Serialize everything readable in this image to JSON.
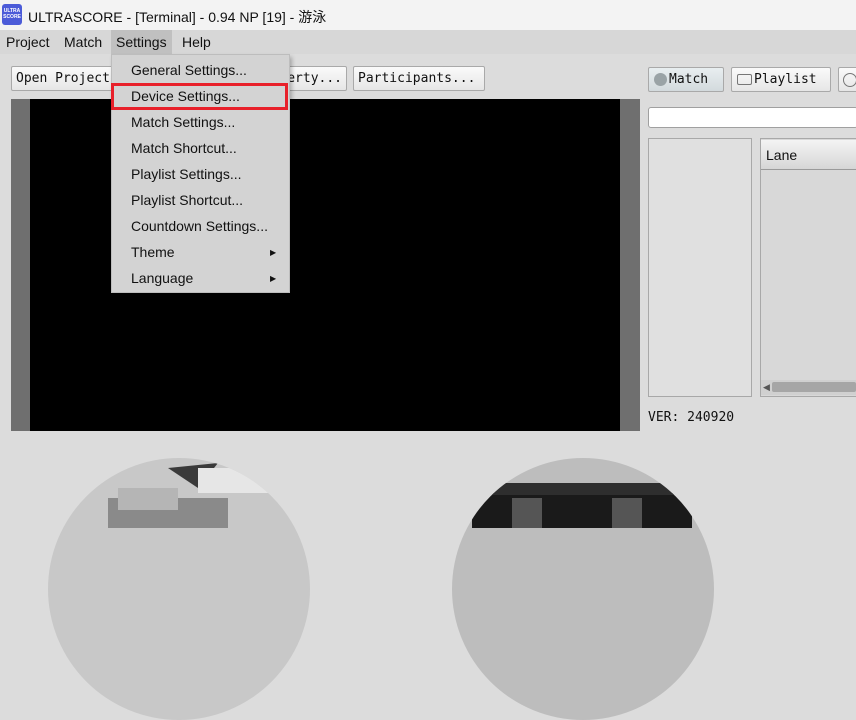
{
  "window": {
    "icon_text": "ULTRA SCORE",
    "title": "ULTRASCORE - [Terminal] - 0.94 NP [19] - 游泳"
  },
  "menubar": {
    "items": [
      "Project",
      "Match",
      "Settings",
      "Help"
    ]
  },
  "toolbar": {
    "open_project": "Open Project...",
    "property": "Property...",
    "participants": "Participants...",
    "match_tab": "Match",
    "playlist_tab": "Playlist"
  },
  "settings_menu": {
    "items": [
      {
        "label": "General Settings...",
        "submenu": false
      },
      {
        "label": "Device Settings...",
        "submenu": false,
        "highlighted": true
      },
      {
        "label": "Match Settings...",
        "submenu": false
      },
      {
        "label": "Match Shortcut...",
        "submenu": false
      },
      {
        "label": "Playlist Settings...",
        "submenu": false
      },
      {
        "label": "Playlist Shortcut...",
        "submenu": false
      },
      {
        "label": "Countdown Settings...",
        "submenu": false
      },
      {
        "label": "Theme",
        "submenu": true
      },
      {
        "label": "Language",
        "submenu": true
      }
    ]
  },
  "right_panel": {
    "search_value": "",
    "table_header": "Lane",
    "version": "VER: 240920"
  },
  "colors": {
    "highlight": "#e8202a",
    "app_icon": "#4b5bd8",
    "video_bg": "#000000"
  }
}
